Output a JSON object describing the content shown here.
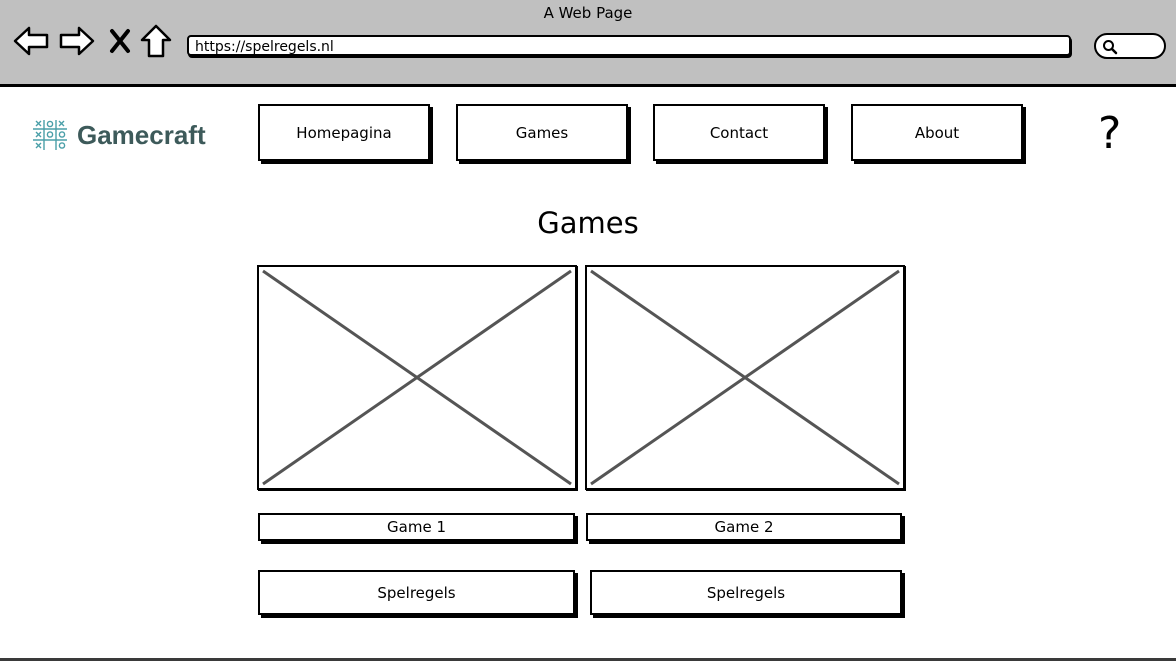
{
  "window": {
    "title": "A Web Page"
  },
  "browser": {
    "url": "https://spelregels.nl",
    "icons": [
      "back-arrow-icon",
      "forward-arrow-icon",
      "close-icon",
      "home-icon",
      "search-icon"
    ]
  },
  "header": {
    "logo_text": "Gamecraft",
    "nav": [
      {
        "label": "Homepagina"
      },
      {
        "label": "Games"
      },
      {
        "label": "Contact"
      },
      {
        "label": "About"
      }
    ],
    "help_symbol": "?"
  },
  "main": {
    "title": "Games",
    "games": [
      {
        "name": "Game 1",
        "rules_label": "Spelregels"
      },
      {
        "name": "Game 2",
        "rules_label": "Spelregels"
      }
    ]
  },
  "colors": {
    "chrome_bg": "#c0c0c0",
    "logo_text": "#3d5a5a",
    "logo_mark": "#4a9fa8"
  }
}
